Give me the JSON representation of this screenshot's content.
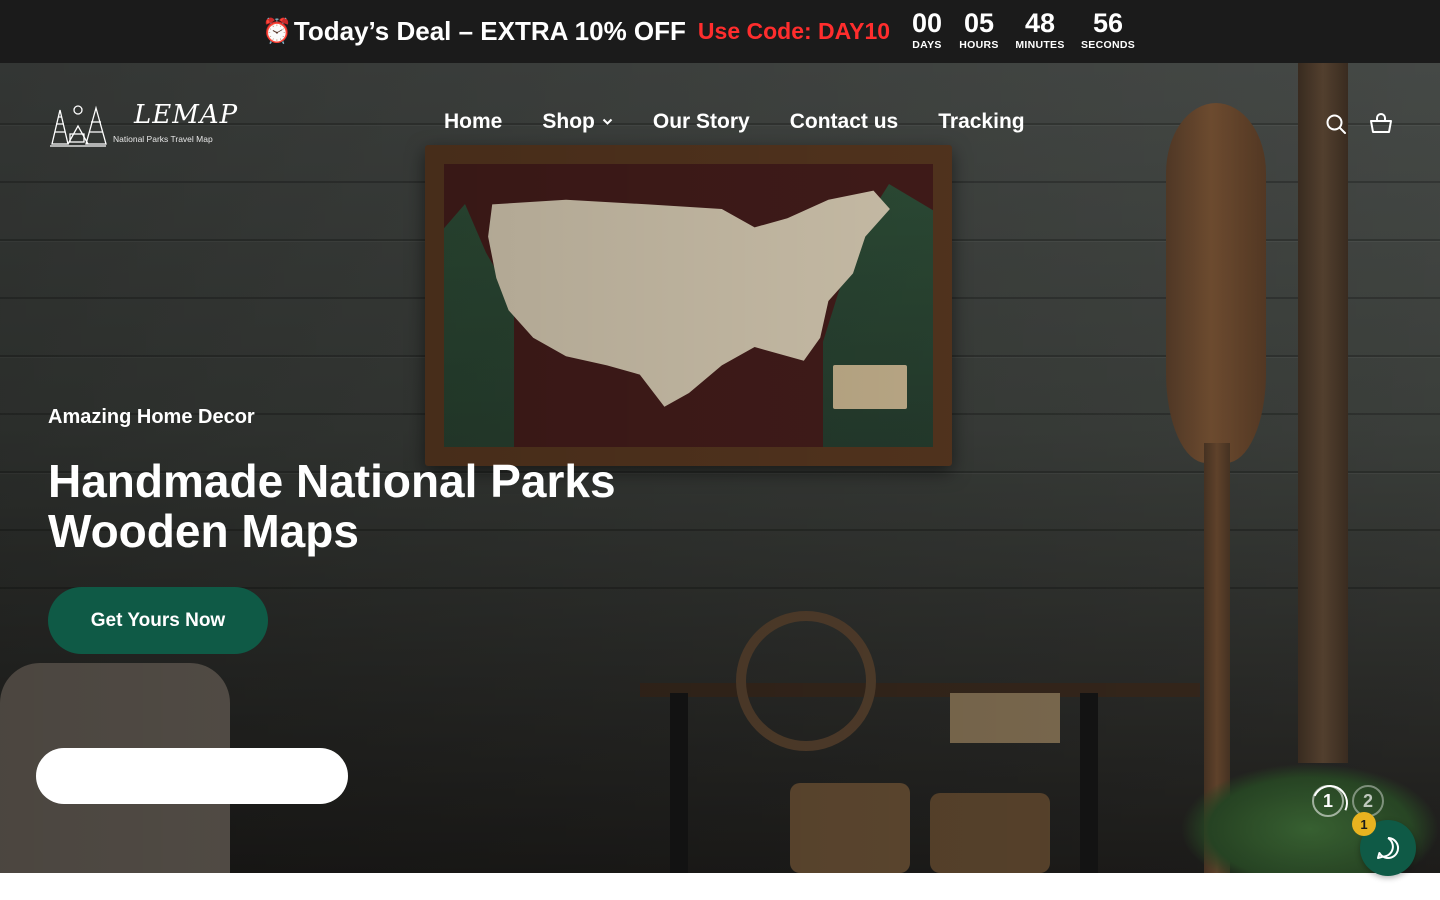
{
  "announcement": {
    "clock_icon": "⏰",
    "deal_text": "Today’s Deal – EXTRA 10% OFF",
    "code_text": "Use Code: DAY10",
    "countdown": [
      {
        "value": "00",
        "label": "DAYS"
      },
      {
        "value": "05",
        "label": "HOURS"
      },
      {
        "value": "48",
        "label": "MINUTES"
      },
      {
        "value": "56",
        "label": "SECONDS"
      }
    ]
  },
  "header": {
    "logo": {
      "name": "LEMAP",
      "tagline": "National Parks Travel Map"
    },
    "nav": [
      {
        "label": "Home"
      },
      {
        "label": "Shop"
      },
      {
        "label": "Our Story"
      },
      {
        "label": "Contact us"
      },
      {
        "label": "Tracking"
      }
    ],
    "icons": [
      "search-icon",
      "cart-icon"
    ]
  },
  "hero": {
    "eyebrow": "Amazing Home Decor",
    "headline": "Handmade National Parks Wooden Maps",
    "cta_label": "Get Yours Now",
    "slides": [
      {
        "label": "1",
        "active": true
      },
      {
        "label": "2",
        "active": false
      }
    ]
  },
  "chat": {
    "badge_count": "1"
  },
  "colors": {
    "topbar": "#1b1b1b",
    "code_accent": "#ff2d2d",
    "brand_green": "#0f5a46",
    "badge_yellow": "#e8b320"
  }
}
